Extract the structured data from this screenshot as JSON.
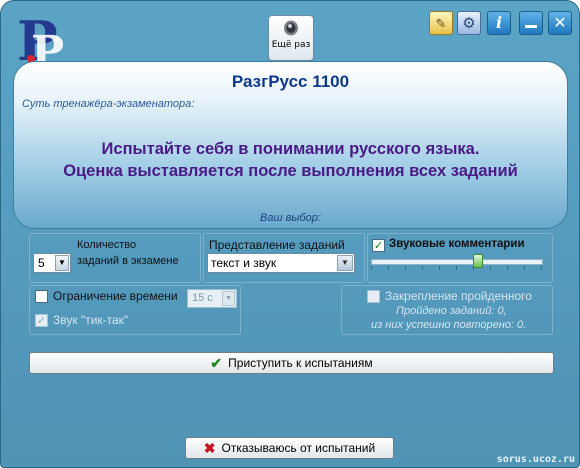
{
  "app": {
    "title": "РазгРусс 1100",
    "subtitle": "Суть тренажёра-экзаменатора:"
  },
  "banner": {
    "line1": "Испытайте себя в понимании русского языка.",
    "line2": "Оценка выставляется после выполнения всех заданий"
  },
  "again_button": {
    "label": "Ещё раз",
    "icon": "speaker-icon"
  },
  "choice_label": "Ваш выбор:",
  "settings": {
    "count": {
      "value": "5",
      "label_line1": "Количество",
      "label_line2": "заданий в экзамене"
    },
    "presentation": {
      "label": "Представление заданий",
      "selected": "текст и звук"
    },
    "sound_comments": {
      "label": "Звуковые комментарии",
      "checked": true,
      "level_fraction": 0.62
    },
    "time_limit": {
      "label": "Ограничение времени",
      "checked": false,
      "value": "15 с"
    },
    "tick_tock": {
      "label": "Звук \"тик-так\"",
      "checked": true,
      "enabled": false
    },
    "consolidation": {
      "label": "Закрепление пройденного",
      "passed": "Пройдено заданий: 0,",
      "repeated": "из них успешно повторено: 0."
    }
  },
  "start_button": {
    "label": "Приступить к испытаниям",
    "icon": "checkmark-icon"
  },
  "refuse_button": {
    "label": "Отказываюсь от испытаний",
    "icon": "cross-icon"
  },
  "footer": "sorus.ucoz.ru",
  "colors": {
    "accent": "#4a1a86",
    "title": "#0d3a8a",
    "window": "#5ba4c6"
  }
}
